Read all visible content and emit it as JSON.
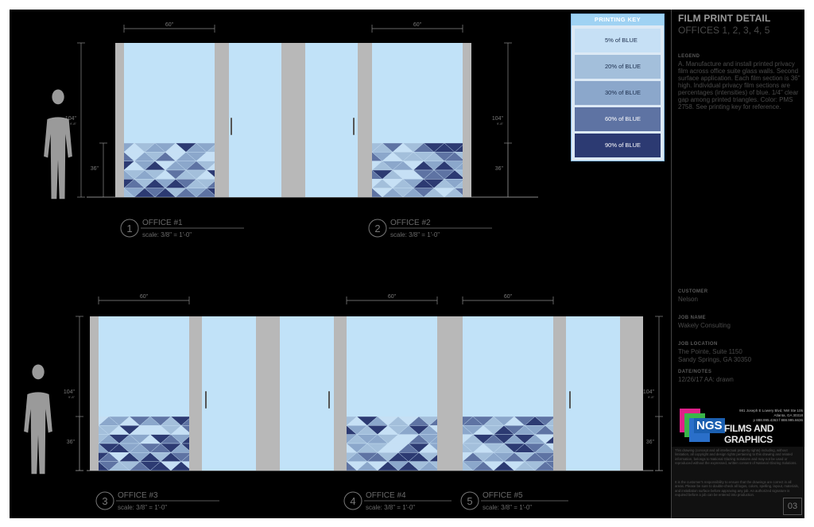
{
  "title_block": {
    "title": "FILM PRINT DETAIL",
    "subtitle": "OFFICES 1, 2, 3, 4, 5",
    "legend_label": "LEGEND",
    "legend_text": "A. Manufacture and install printed privacy film across office suite glass walls. Second surface application. Each film section is 36\" high. Individual privacy film sections are percentages (intensities) of blue. 1/4\" clear gap among printed triangles. Color: PMS 2758. See printing key for reference.",
    "customer_label": "CUSTOMER",
    "customer": "Nelson",
    "job_name_label": "JOB NAME",
    "job_name": "Wakely Consulting",
    "job_location_label": "JOB LOCATION",
    "job_location_line1": "The Pointe, Suite 1150",
    "job_location_line2": "Sandy Springs, GA 30350",
    "date_label": "DATE/NOTES",
    "date_notes": "12/26/17 AA: drawn",
    "logo_ngs": "NGS",
    "logo_films": "FILMS AND GRAPHICS",
    "address_line1": "981 Joseph E Lowery Blvd, NW Ste 105",
    "address_line2": "Atlanta, GA 30318",
    "address_line3": "p 888.995.4363      f 888.995.6636",
    "legal_1": "This drawing (concept and all intellectual property rights) including, without limitation, all copyright and design rights pertaining to this drawing and related information, belongs to National Glazing Solutions and may not be used or reproduced without the expressed, written consent of National Glazing Solutions.",
    "legal_2": "It is the customer's responsibility to ensure that the drawings are correct in all areas. Please be sure to double-check all logos, colors, spelling, layout, materials, and installation surface before approving any job. An authorized signature is required before a job can be entered into production.",
    "sheet_number": "03"
  },
  "printing_key": {
    "title": "PRINTING KEY",
    "items": [
      {
        "label": "5% of BLUE",
        "color": "#c6e0f5"
      },
      {
        "label": "20% of BLUE",
        "color": "#a3bfdb"
      },
      {
        "label": "30% of BLUE",
        "color": "#8ba7cb"
      },
      {
        "label": "60% of BLUE",
        "color": "#5e73a3"
      },
      {
        "label": "90% of BLUE",
        "color": "#2c3a72"
      }
    ]
  },
  "elevations": {
    "dim_width": "60\"",
    "dim_height": "104\"",
    "dim_height_sub": "9'-8\"",
    "dim_film": "36\"",
    "scale": "scale: 3/8\" = 1'-0\"",
    "offices": [
      {
        "number": "1",
        "label": "OFFICE #1"
      },
      {
        "number": "2",
        "label": "OFFICE #2"
      },
      {
        "number": "3",
        "label": "OFFICE #3"
      },
      {
        "number": "4",
        "label": "OFFICE #4"
      },
      {
        "number": "5",
        "label": "OFFICE #5"
      }
    ]
  },
  "colors": {
    "glass": "#c1e2f8",
    "mullion": "#b8b8b8",
    "line": "#8a8a8a"
  }
}
